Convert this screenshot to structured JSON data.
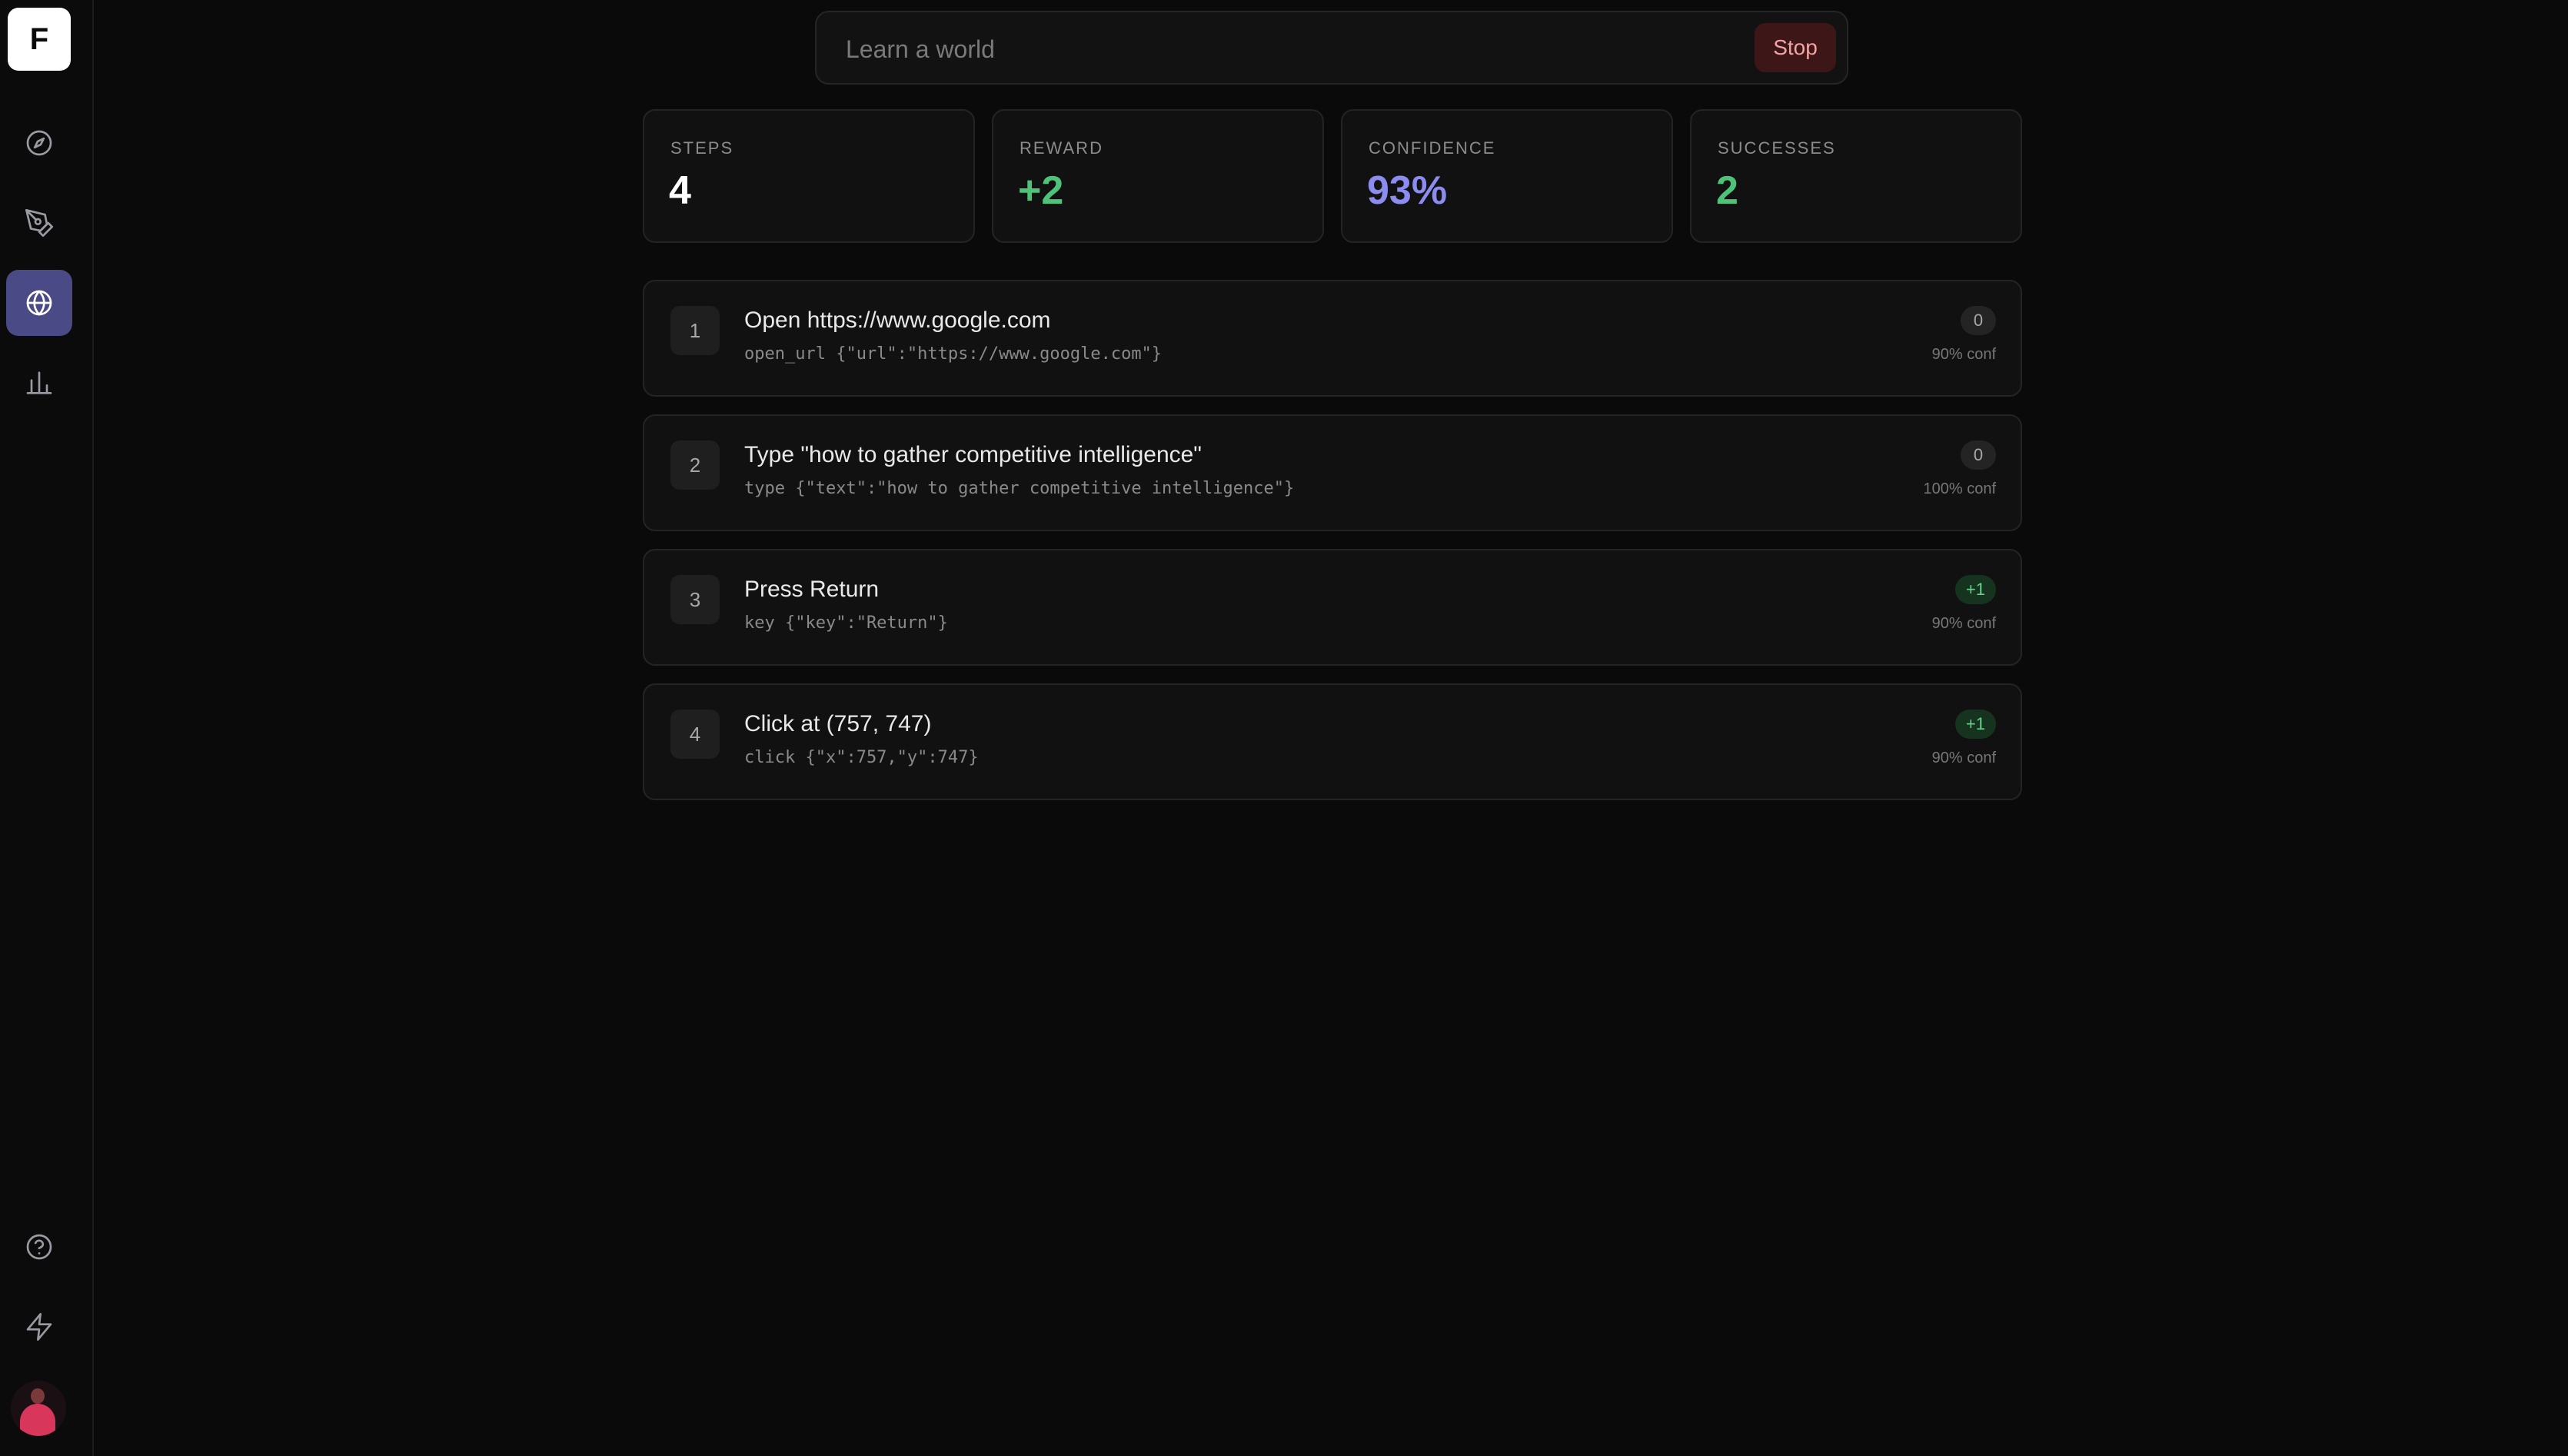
{
  "app": {
    "logo_letter": "F"
  },
  "sidebar": {
    "nav": [
      {
        "name": "explore",
        "icon": "compass-icon",
        "active": false
      },
      {
        "name": "create",
        "icon": "pen-tool-icon",
        "active": false
      },
      {
        "name": "worlds",
        "icon": "globe-icon",
        "active": true
      },
      {
        "name": "analytics",
        "icon": "bar-chart-icon",
        "active": false
      }
    ],
    "bottom": [
      {
        "name": "help",
        "icon": "help-circle-icon"
      },
      {
        "name": "actions",
        "icon": "lightning-icon"
      }
    ]
  },
  "search": {
    "placeholder": "Learn a world",
    "value": "",
    "stop_label": "Stop"
  },
  "stats": [
    {
      "label": "STEPS",
      "value": "4",
      "color": "#ffffff"
    },
    {
      "label": "REWARD",
      "value": "+2",
      "color": "#4fc27a"
    },
    {
      "label": "CONFIDENCE",
      "value": "93%",
      "color": "#8b8bf0"
    },
    {
      "label": "SUCCESSES",
      "value": "2",
      "color": "#4fc27a"
    }
  ],
  "steps": [
    {
      "num": "1",
      "title": "Open https://www.google.com",
      "code": "open_url {\"url\":\"https://www.google.com\"}",
      "reward": "0",
      "conf": "90% conf"
    },
    {
      "num": "2",
      "title": "Type \"how to gather competitive intelligence\"",
      "code": "type {\"text\":\"how to gather competitive intelligence\"}",
      "reward": "0",
      "conf": "100% conf"
    },
    {
      "num": "3",
      "title": "Press Return",
      "code": "key {\"key\":\"Return\"}",
      "reward": "+1",
      "conf": "90% conf"
    },
    {
      "num": "4",
      "title": "Click at (757, 747)",
      "code": "click {\"x\":757,\"y\":747}",
      "reward": "+1",
      "conf": "90% conf"
    }
  ]
}
